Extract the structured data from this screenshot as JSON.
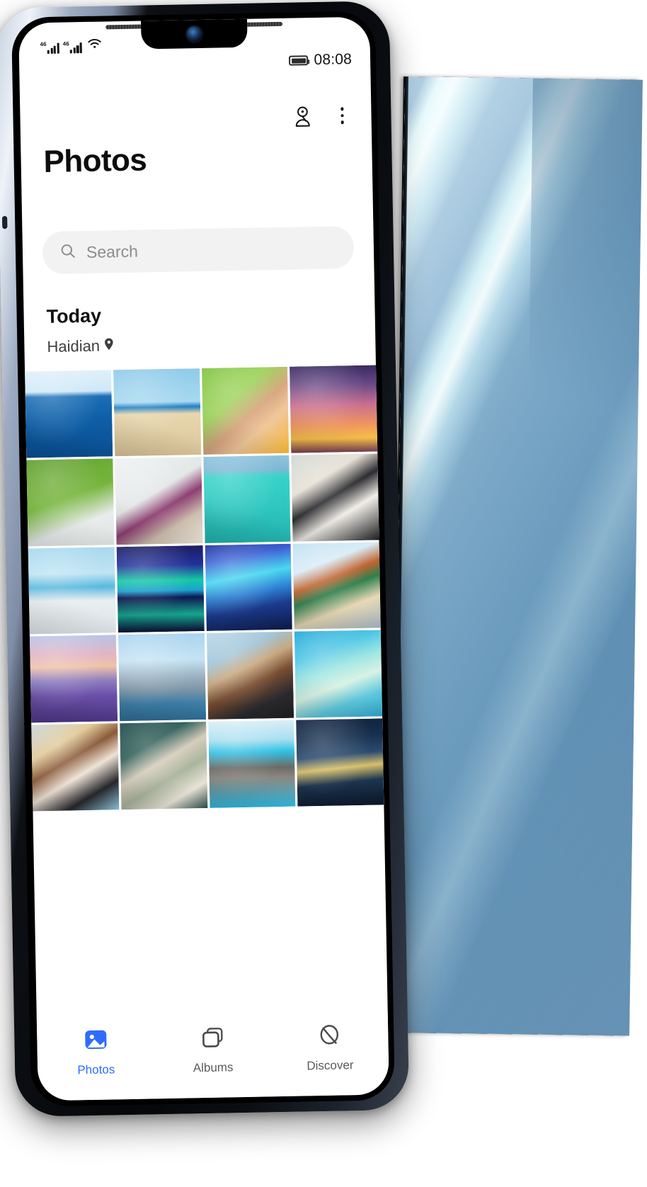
{
  "status_bar": {
    "signal_1": "signal-bars-icon",
    "signal_2": "signal-bars-icon",
    "wifi": "wifi-icon",
    "battery": "battery-icon",
    "time": "08:08"
  },
  "header": {
    "title": "Photos",
    "location_icon": "location-person-icon",
    "menu_icon": "more-vertical-icon"
  },
  "search": {
    "icon": "search-icon",
    "placeholder": "Search",
    "value": ""
  },
  "section": {
    "title": "Today",
    "place": "Haidian",
    "place_icon": "map-pin-icon"
  },
  "grid": {
    "columns": 4,
    "photos": [
      {
        "name": "ocean-waves",
        "k": "ocean"
      },
      {
        "name": "child-on-beach",
        "k": "beach-kid"
      },
      {
        "name": "woman-portrait-grass",
        "k": "portrait-grass"
      },
      {
        "name": "sunset-clouds",
        "k": "sunset"
      },
      {
        "name": "kid-lying-on-grass",
        "k": "grass-kid"
      },
      {
        "name": "girl-jumping-indoors",
        "k": "indoor"
      },
      {
        "name": "snorkeler-turquoise-sea",
        "k": "turquoise"
      },
      {
        "name": "woman-hat-sunglasses",
        "k": "hat-woman"
      },
      {
        "name": "infinity-pool",
        "k": "pool"
      },
      {
        "name": "aurora-over-lake",
        "k": "aurora-lake"
      },
      {
        "name": "aurora-over-mountain",
        "k": "aurora-mtn"
      },
      {
        "name": "saint-basil-cathedral",
        "k": "cathedral"
      },
      {
        "name": "lavender-field-sunset",
        "k": "lavender"
      },
      {
        "name": "city-skyline-bay",
        "k": "skyline"
      },
      {
        "name": "woman-selfie-coast",
        "k": "selfie-coast"
      },
      {
        "name": "aerial-turquoise-shore",
        "k": "aerial"
      },
      {
        "name": "woman-straw-hat",
        "k": "straw-hat"
      },
      {
        "name": "woman-green-jacket",
        "k": "green-jacket"
      },
      {
        "name": "poolside-loungers",
        "k": "loungers"
      },
      {
        "name": "night-city-harbor",
        "k": "night-city"
      }
    ]
  },
  "tabbar": {
    "items": [
      {
        "label": "Photos",
        "icon": "photo-icon",
        "active": true
      },
      {
        "label": "Albums",
        "icon": "albums-stack-icon",
        "active": false
      },
      {
        "label": "Discover",
        "icon": "discover-circle-icon",
        "active": false
      }
    ]
  },
  "device": {
    "front_frame_color": "#0a0d12",
    "front_frame_edge_color": "#c3cede",
    "back_panel_color": "#6b9bbd",
    "back_panel_highlight": "#bdf0ee"
  },
  "theme": {
    "accent": "#2f6bff",
    "text_primary": "#0d0d0d",
    "text_secondary": "#5a5a5a",
    "search_bg": "#f2f2f2",
    "screen_bg": "#ffffff"
  }
}
